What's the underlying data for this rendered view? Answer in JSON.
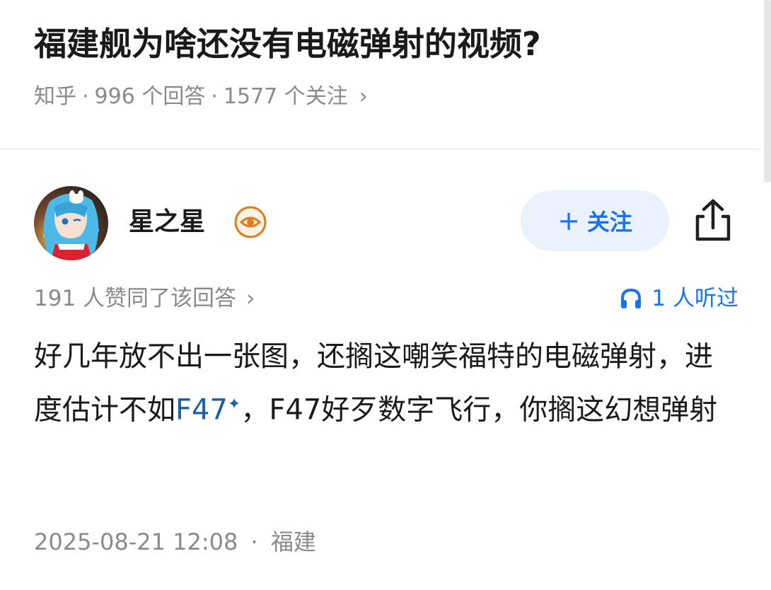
{
  "question": {
    "title": "福建舰为啥还没有电磁弹射的视频?",
    "source": "知乎",
    "answers": "996 个回答",
    "followers": "1577 个关注",
    "separator": "·",
    "chevron": "›"
  },
  "author": {
    "name": "星之星",
    "badge_icon": "eye-badge-icon",
    "avatar_icon": "anime-avatar"
  },
  "actions": {
    "follow_plus": "+",
    "follow_label": "关注",
    "share_icon": "share-icon"
  },
  "stats": {
    "agree": "191 人赞同了该回答",
    "chevron": "›",
    "listen": "1 人听过",
    "listen_icon": "headphones-icon"
  },
  "answer": {
    "part1": "好几年放不出一张图，还搁这嘲笑福特的电磁弹射，进度估计不如",
    "link": "F47",
    "spark": "✦",
    "part2": "，F47好歹数字飞行，你搁这幻想弹射"
  },
  "post": {
    "datetime": "2025-08-21 12:08",
    "separator": "·",
    "location": "福建"
  },
  "colors": {
    "accent": "#1772f6",
    "follow_bg": "#e9f1fd",
    "link": "#1b5ea8",
    "muted": "#8a8a8a",
    "badge": "#e07a1f"
  }
}
